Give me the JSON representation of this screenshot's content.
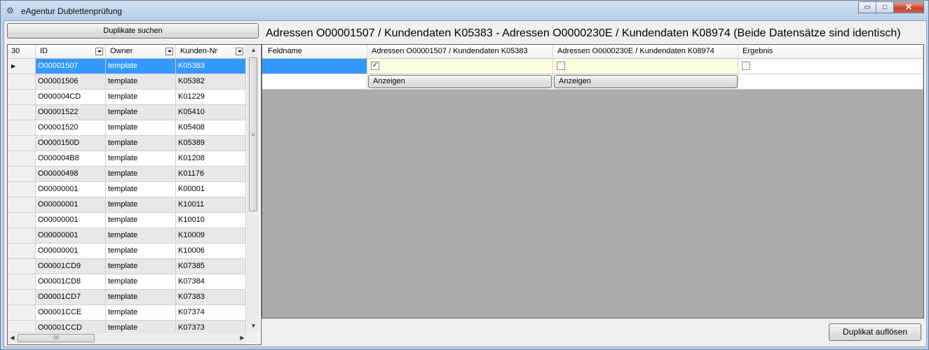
{
  "window": {
    "title": "eAgentur Dublettenprüfung",
    "buttons": {
      "minimize": "▭",
      "maximize": "□",
      "close": "✕"
    }
  },
  "toolbar": {
    "search_label": "Duplikate suchen"
  },
  "header": {
    "text": "Adressen O00001507 / Kundendaten K05383 - Adressen O0000230E / Kundendaten K08974 (Beide Datensätze sind identisch)"
  },
  "left_grid": {
    "count": "30",
    "columns": [
      "ID",
      "Owner",
      "Kunden-Nr"
    ],
    "selected_row": 0,
    "rows": [
      {
        "id": "O00001507",
        "owner": "template",
        "kunden_nr": "K05383"
      },
      {
        "id": "O00001506",
        "owner": "template",
        "kunden_nr": "K05382"
      },
      {
        "id": "O000004CD",
        "owner": "template",
        "kunden_nr": "K01229"
      },
      {
        "id": "O00001522",
        "owner": "template",
        "kunden_nr": "K05410"
      },
      {
        "id": "O00001520",
        "owner": "template",
        "kunden_nr": "K05408"
      },
      {
        "id": "O0000150D",
        "owner": "template",
        "kunden_nr": "K05389"
      },
      {
        "id": "O000004B8",
        "owner": "template",
        "kunden_nr": "K01208"
      },
      {
        "id": "O00000498",
        "owner": "template",
        "kunden_nr": "K01176"
      },
      {
        "id": "O00000001",
        "owner": "template",
        "kunden_nr": "K00001"
      },
      {
        "id": "O00000001",
        "owner": "template",
        "kunden_nr": "K10011"
      },
      {
        "id": "O00000001",
        "owner": "template",
        "kunden_nr": "K10010"
      },
      {
        "id": "O00000001",
        "owner": "template",
        "kunden_nr": "K10009"
      },
      {
        "id": "O00000001",
        "owner": "template",
        "kunden_nr": "K10006"
      },
      {
        "id": "O00001CD9",
        "owner": "template",
        "kunden_nr": "K07385"
      },
      {
        "id": "O00001CD8",
        "owner": "template",
        "kunden_nr": "K07384"
      },
      {
        "id": "O00001CD7",
        "owner": "template",
        "kunden_nr": "K07383"
      },
      {
        "id": "O00001CCE",
        "owner": "template",
        "kunden_nr": "K07374"
      },
      {
        "id": "O00001CCD",
        "owner": "template",
        "kunden_nr": "K07373"
      }
    ]
  },
  "right_grid": {
    "columns": [
      "Feldname",
      "Adressen O00001507 / Kundendaten K05383",
      "Adressen O0000230E / Kundendaten K08974",
      "Ergebnis"
    ],
    "row1": {
      "checked_a": true,
      "checked_b": false,
      "checked_result": false
    },
    "row2": {
      "show_a_label": "Anzeigen",
      "show_b_label": "Anzeigen"
    }
  },
  "footer": {
    "resolve_label": "Duplikat auflösen"
  },
  "icons": {
    "row_pointer": "▶",
    "scroll_up": "▲",
    "scroll_down": "▼",
    "scroll_left": "◀",
    "scroll_right": "▶",
    "grip_v": "≡",
    "grip_h": "III",
    "check": "✓"
  },
  "colors": {
    "selection": "#3399ff",
    "highlight_row": "#ffffe1",
    "alt_row": "#e8e8e8",
    "empty_area": "#ababab"
  }
}
